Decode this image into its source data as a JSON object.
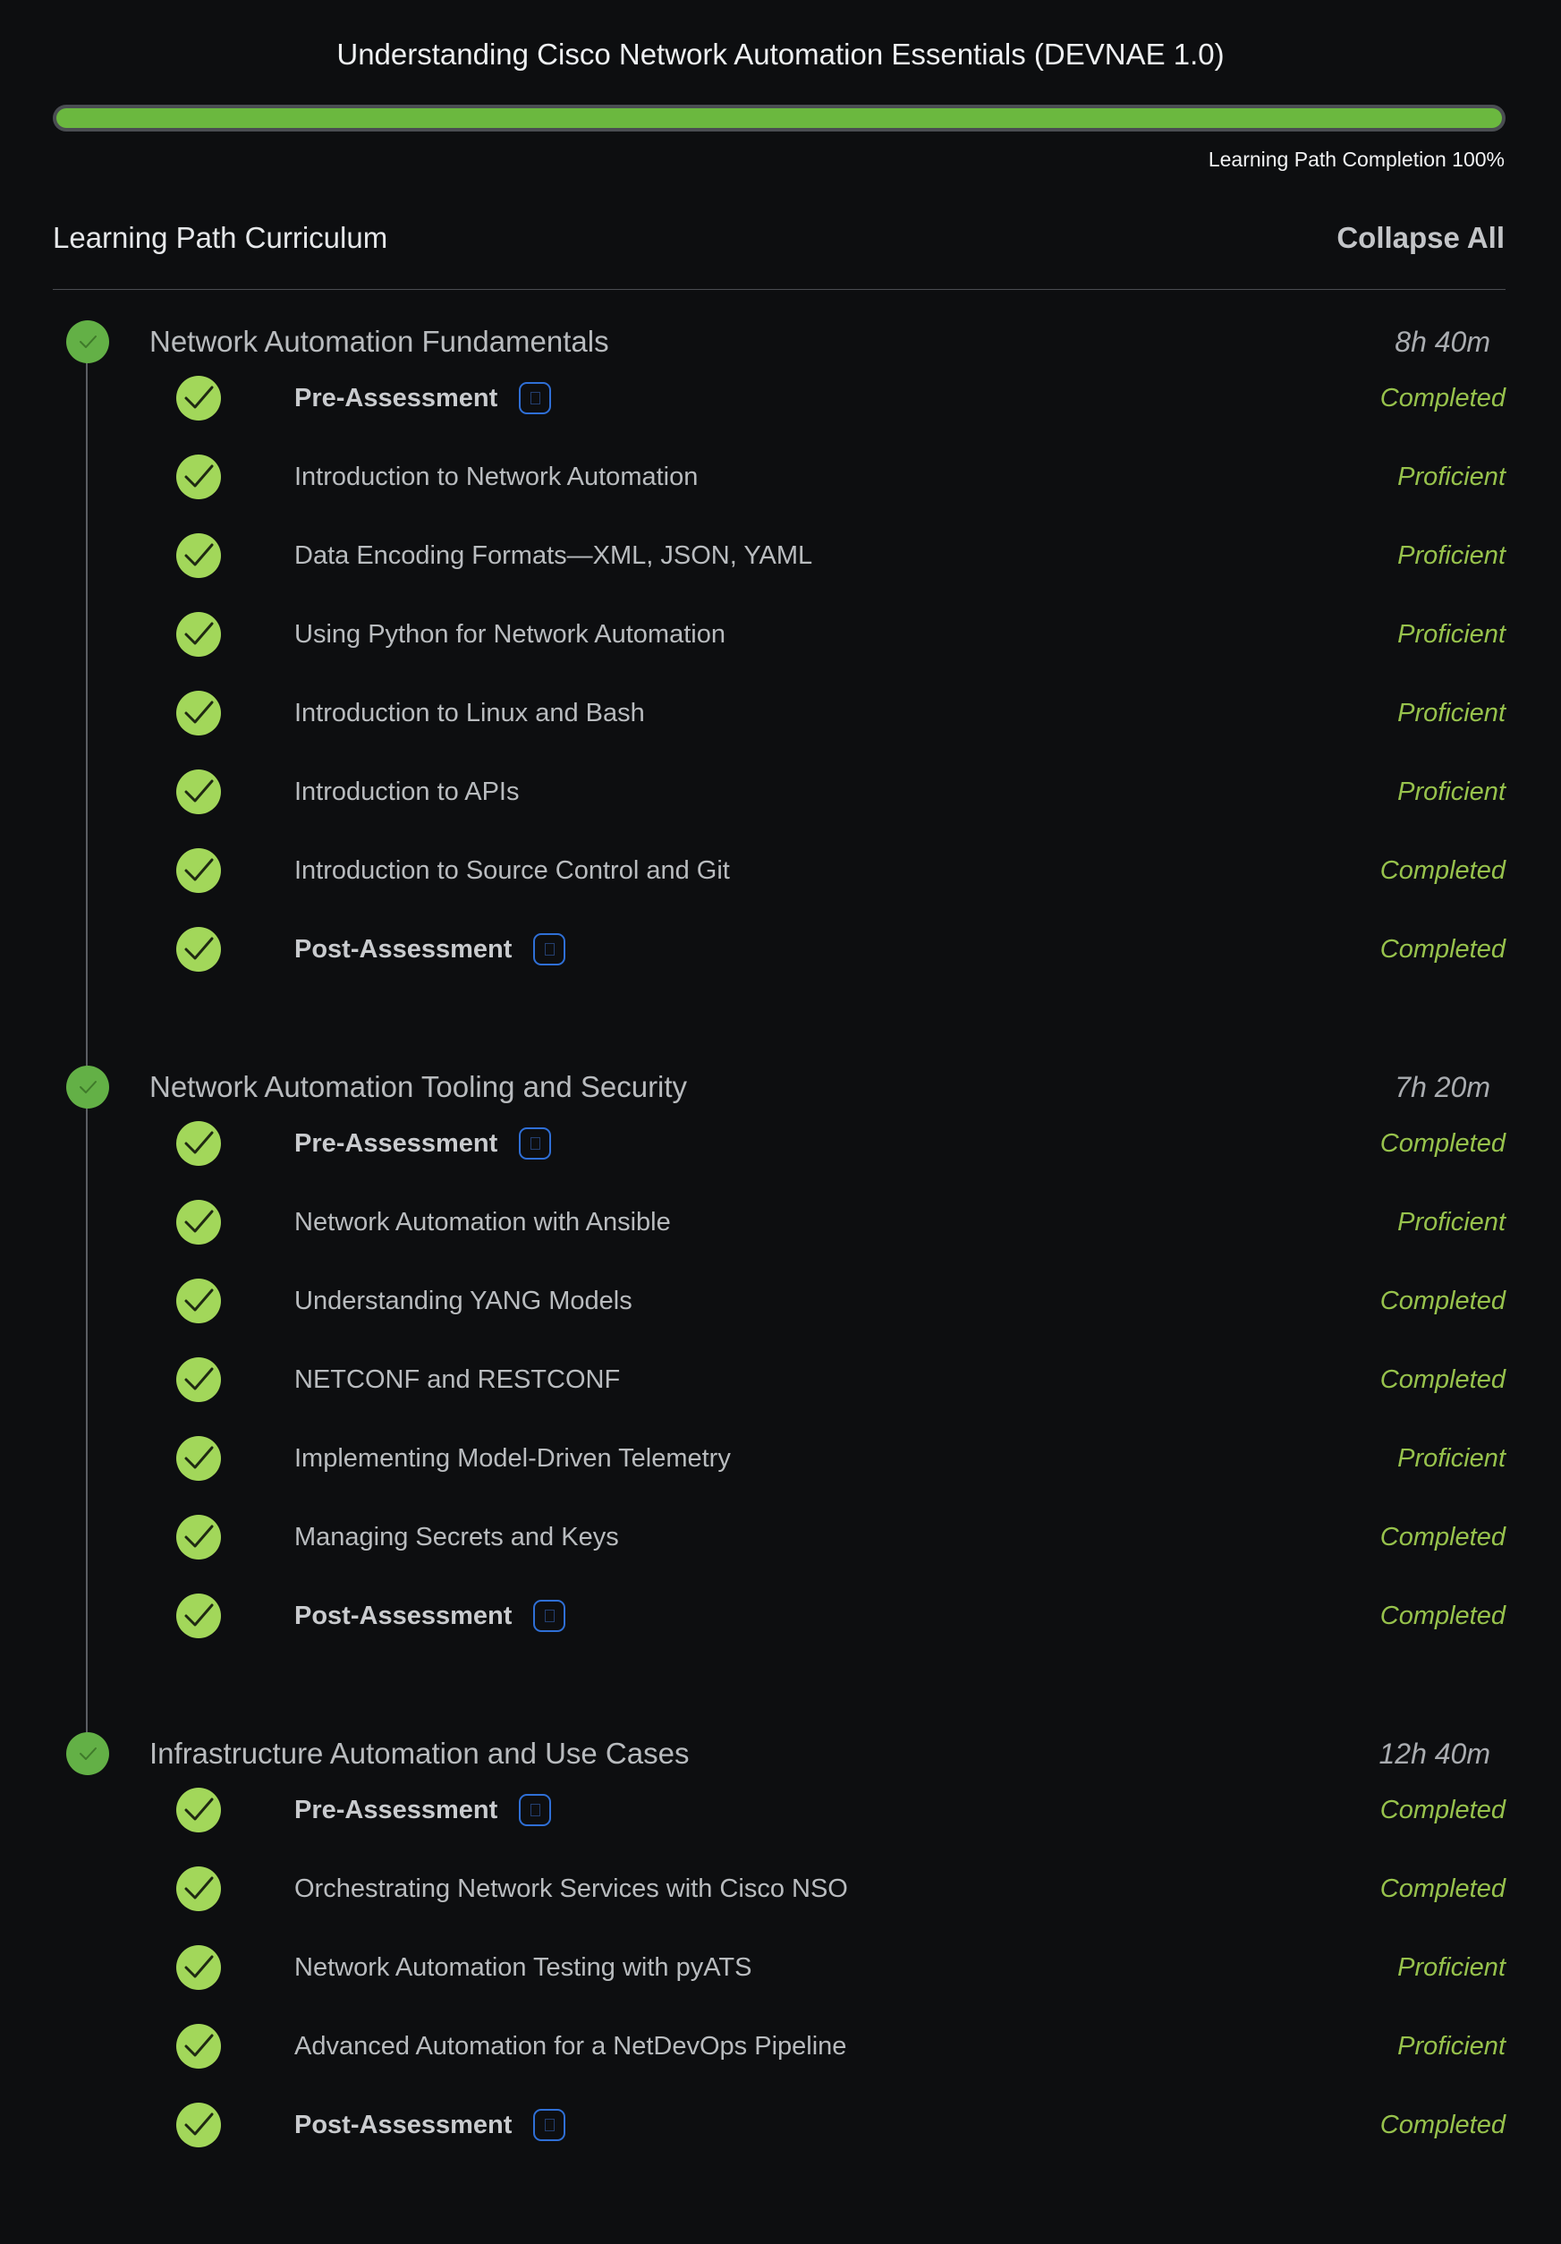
{
  "header": {
    "title": "Understanding Cisco Network Automation Essentials (DEVNAE 1.0)",
    "completion_label": "Learning Path Completion 100%",
    "completion_percent": 100
  },
  "curriculum": {
    "heading": "Learning Path Curriculum",
    "collapse_label": "Collapse All"
  },
  "colors": {
    "progress": "#6bb83f",
    "check": "#a2d75a",
    "module_dot": "#63b046",
    "status": "#97c24c",
    "badge_border": "#2f6fd6"
  },
  "modules": [
    {
      "title": "Network Automation Fundamentals",
      "duration": "8h 40m",
      "lessons": [
        {
          "title": "Pre-Assessment",
          "status": "Completed",
          "assessment": true
        },
        {
          "title": "Introduction to Network Automation",
          "status": "Proficient",
          "assessment": false
        },
        {
          "title": "Data Encoding Formats—XML, JSON, YAML",
          "status": "Proficient",
          "assessment": false
        },
        {
          "title": "Using Python for Network Automation",
          "status": "Proficient",
          "assessment": false
        },
        {
          "title": "Introduction to Linux and Bash",
          "status": "Proficient",
          "assessment": false
        },
        {
          "title": "Introduction to APIs",
          "status": "Proficient",
          "assessment": false
        },
        {
          "title": "Introduction to Source Control and Git",
          "status": "Completed",
          "assessment": false
        },
        {
          "title": "Post-Assessment",
          "status": "Completed",
          "assessment": true
        }
      ]
    },
    {
      "title": "Network Automation Tooling and Security",
      "duration": "7h 20m",
      "lessons": [
        {
          "title": "Pre-Assessment",
          "status": "Completed",
          "assessment": true
        },
        {
          "title": "Network Automation with Ansible",
          "status": "Proficient",
          "assessment": false
        },
        {
          "title": "Understanding YANG Models",
          "status": "Completed",
          "assessment": false
        },
        {
          "title": "NETCONF and RESTCONF",
          "status": "Completed",
          "assessment": false
        },
        {
          "title": "Implementing Model-Driven Telemetry",
          "status": "Proficient",
          "assessment": false
        },
        {
          "title": "Managing Secrets and Keys",
          "status": "Completed",
          "assessment": false
        },
        {
          "title": "Post-Assessment",
          "status": "Completed",
          "assessment": true
        }
      ]
    },
    {
      "title": "Infrastructure Automation and Use Cases",
      "duration": "12h 40m",
      "lessons": [
        {
          "title": "Pre-Assessment",
          "status": "Completed",
          "assessment": true
        },
        {
          "title": "Orchestrating Network Services with Cisco NSO",
          "status": "Completed",
          "assessment": false
        },
        {
          "title": "Network Automation Testing with pyATS",
          "status": "Proficient",
          "assessment": false
        },
        {
          "title": "Advanced Automation for a NetDevOps Pipeline",
          "status": "Proficient",
          "assessment": false
        },
        {
          "title": "Post-Assessment",
          "status": "Completed",
          "assessment": true
        }
      ]
    }
  ]
}
